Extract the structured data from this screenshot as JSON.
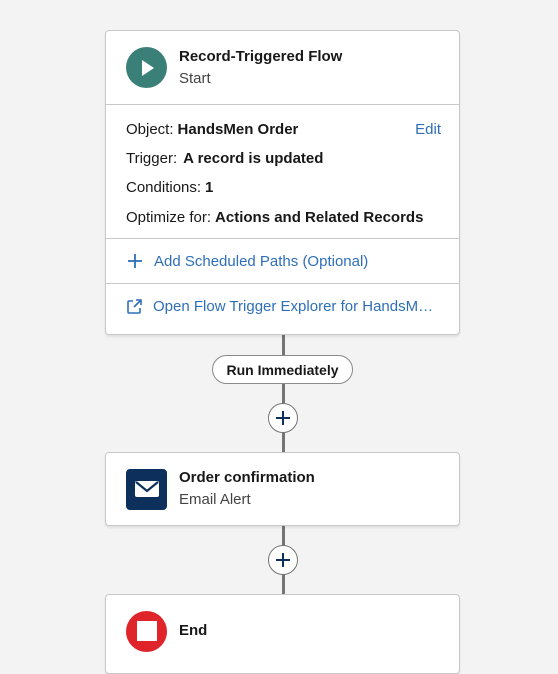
{
  "start_node": {
    "title": "Record-Triggered Flow",
    "subtitle": "Start",
    "icon": "play-icon",
    "object_label": "Object:",
    "object_value": "HandsMen Order",
    "edit_label": "Edit",
    "trigger_label": "Trigger:",
    "trigger_value": "A record is updated",
    "conditions_label": "Conditions:",
    "conditions_value": "1",
    "optimize_label": "Optimize for:",
    "optimize_value": "Actions and Related Records",
    "add_paths_label": "Add Scheduled Paths (Optional)",
    "explorer_label": "Open Flow Trigger Explorer for HandsMen Order"
  },
  "path_label": "Run Immediately",
  "email_node": {
    "title": "Order confirmation",
    "subtitle": "Email Alert",
    "icon": "envelope-icon"
  },
  "end_node": {
    "title": "End",
    "icon": "stop-icon"
  },
  "colors": {
    "start_icon": "#3b8078",
    "email_icon": "#0c2f5c",
    "end_icon": "#e0252a",
    "link": "#2e6fb7",
    "canvas": "#f3f3f3"
  }
}
